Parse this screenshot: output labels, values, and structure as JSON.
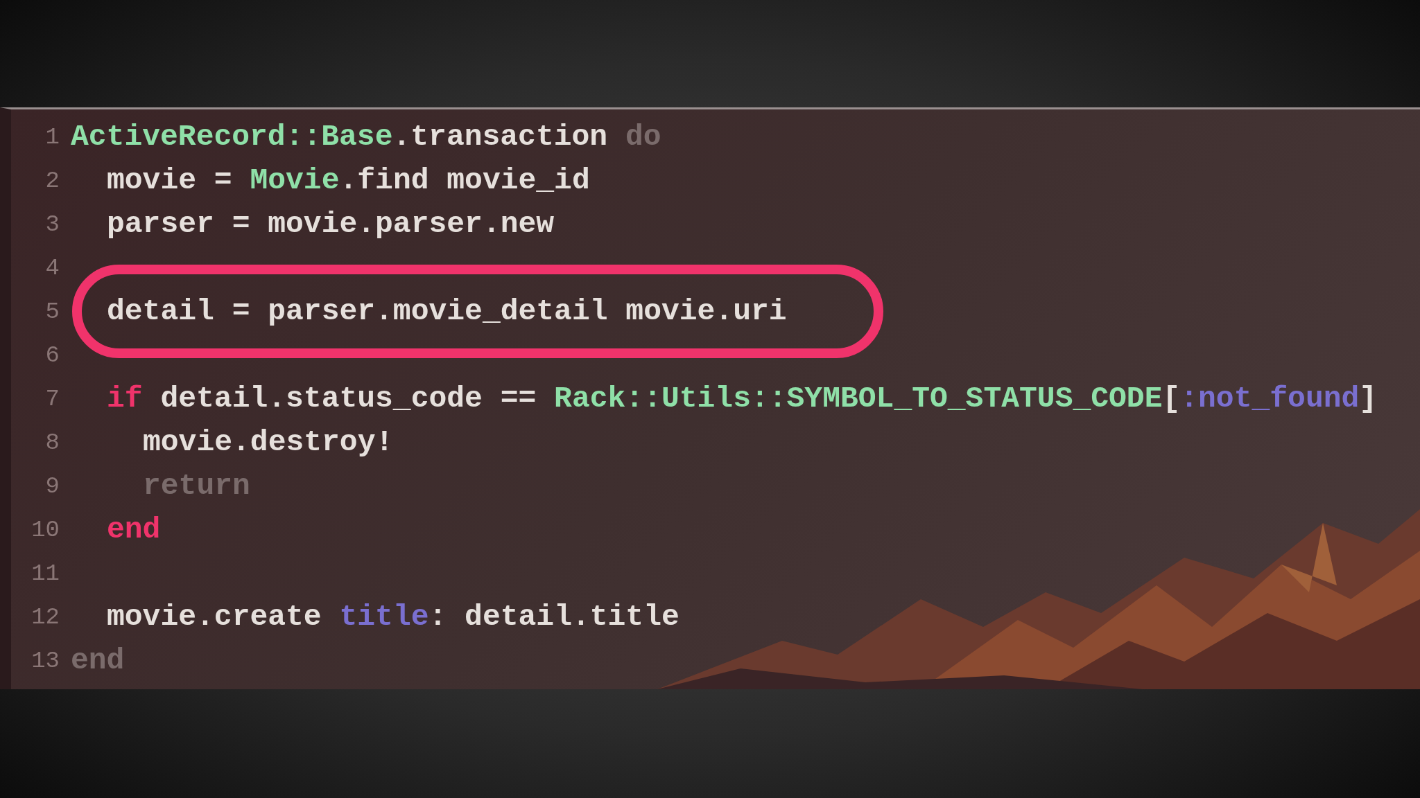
{
  "editor": {
    "lines": [
      {
        "number": "1",
        "highlighted": false,
        "tokens": [
          {
            "text": "ActiveRecord::Base",
            "kind": "constant"
          },
          {
            "text": ".transaction ",
            "kind": "plain"
          },
          {
            "text": "do",
            "kind": "muted"
          }
        ],
        "children": [
          {
            "number": "2",
            "highlighted": false,
            "tokens": [
              {
                "text": "movie = ",
                "kind": "plain"
              },
              {
                "text": "Movie",
                "kind": "constant"
              },
              {
                "text": ".find movie_id",
                "kind": "plain"
              }
            ]
          },
          {
            "number": "3",
            "highlighted": false,
            "tokens": [
              {
                "text": "parser = movie.parser.new",
                "kind": "plain"
              }
            ]
          },
          {
            "number": "4",
            "highlighted": false
          },
          {
            "number": "5",
            "highlighted": true,
            "tokens": [
              {
                "text": "detail = parser.movie_detail movie.uri",
                "kind": "plain"
              }
            ]
          },
          {
            "number": "6",
            "highlighted": false
          },
          {
            "number": "7",
            "highlighted": false,
            "tokens": [
              {
                "text": "if",
                "kind": "keyword"
              },
              {
                "text": " detail.status_code == ",
                "kind": "plain"
              },
              {
                "text": "Rack::Utils::SYMBOL_TO_STATUS_CODE",
                "kind": "constant"
              },
              {
                "text": "[",
                "kind": "plain"
              },
              {
                "text": ":not_found",
                "kind": "symbol"
              },
              {
                "text": "]",
                "kind": "plain"
              }
            ],
            "children": [
              {
                "number": "8",
                "highlighted": false,
                "tokens": [
                  {
                    "text": "movie.destroy!",
                    "kind": "plain"
                  }
                ]
              },
              {
                "number": "9",
                "highlighted": false,
                "tokens": [
                  {
                    "text": "return",
                    "kind": "muted"
                  }
                ]
              }
            ]
          },
          {
            "number": "10",
            "highlighted": false,
            "tokens": [
              {
                "text": "end",
                "kind": "keyword"
              }
            ]
          },
          {
            "number": "11",
            "highlighted": false
          },
          {
            "number": "12",
            "highlighted": false,
            "tokens": [
              {
                "text": "movie.create ",
                "kind": "plain"
              },
              {
                "text": "title",
                "kind": "symbol"
              },
              {
                "text": ": detail.title",
                "kind": "plain"
              }
            ]
          }
        ]
      },
      {
        "number": "13",
        "highlighted": false,
        "tokens": [
          {
            "text": "end",
            "kind": "muted"
          }
        ]
      }
    ]
  }
}
